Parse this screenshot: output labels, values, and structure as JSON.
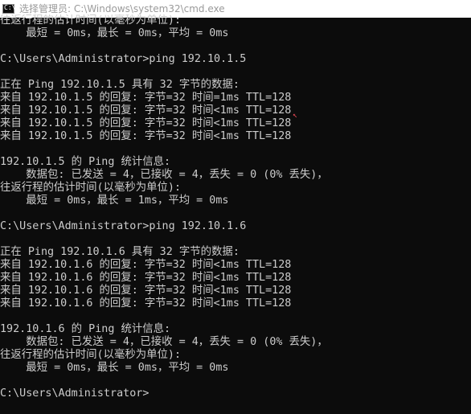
{
  "window": {
    "title": "选择管理员: C:\\Windows\\system32\\cmd.exe",
    "icon": "cmd-icon",
    "icon_prompt": "C:\\"
  },
  "console": {
    "lines": [
      "往返行程的估计时间(以毫秒为单位):",
      "    最短 = 0ms，最长 = 0ms，平均 = 0ms",
      "",
      "C:\\Users\\Administrator>ping 192.10.1.5",
      "",
      "正在 Ping 192.10.1.5 具有 32 字节的数据:",
      "来自 192.10.1.5 的回复: 字节=32 时间=1ms TTL=128",
      "来自 192.10.1.5 的回复: 字节=32 时间<1ms TTL=128",
      "来自 192.10.1.5 的回复: 字节=32 时间<1ms TTL=128",
      "来自 192.10.1.5 的回复: 字节=32 时间<1ms TTL=128",
      "",
      "192.10.1.5 的 Ping 统计信息:",
      "    数据包: 已发送 = 4，已接收 = 4，丢失 = 0 (0% 丢失)，",
      "往返行程的估计时间(以毫秒为单位):",
      "    最短 = 0ms，最长 = 1ms，平均 = 0ms",
      "",
      "C:\\Users\\Administrator>ping 192.10.1.6",
      "",
      "正在 Ping 192.10.1.6 具有 32 字节的数据:",
      "来自 192.10.1.6 的回复: 字节=32 时间<1ms TTL=128",
      "来自 192.10.1.6 的回复: 字节=32 时间<1ms TTL=128",
      "来自 192.10.1.6 的回复: 字节=32 时间<1ms TTL=128",
      "来自 192.10.1.6 的回复: 字节=32 时间<1ms TTL=128",
      "",
      "192.10.1.6 的 Ping 统计信息:",
      "    数据包: 已发送 = 4，已接收 = 4，丢失 = 0 (0% 丢失)，",
      "往返行程的估计时间(以毫秒为单位):",
      "    最短 = 0ms，最长 = 0ms，平均 = 0ms",
      "",
      "C:\\Users\\Administrator>"
    ],
    "mouse_cursor_glyph": "↖"
  },
  "colors": {
    "console_background": "#0c0c0c",
    "console_text": "#cccccc",
    "titlebar_background": "#ffffff",
    "title_text": "#9a9a9a",
    "cursor_mark": "#e74856"
  }
}
